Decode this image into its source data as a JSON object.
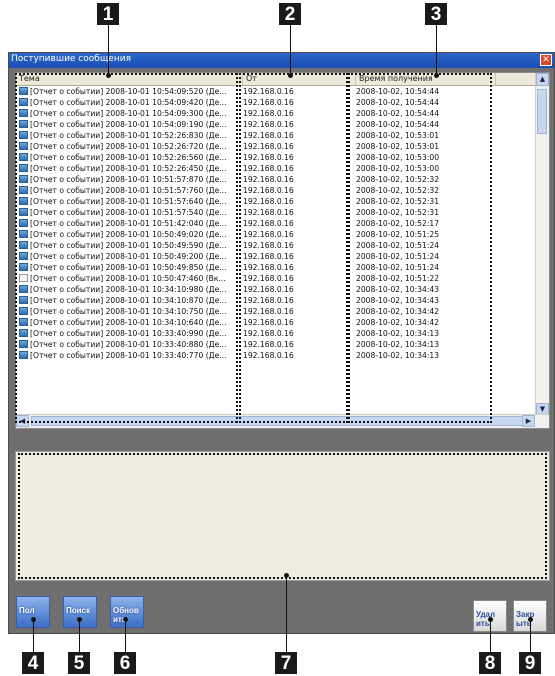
{
  "callouts": [
    "1",
    "2",
    "3",
    "4",
    "5",
    "6",
    "7",
    "8",
    "9"
  ],
  "window": {
    "title": "Поступившие сообщения",
    "close_glyph": "✕"
  },
  "columns": [
    "Тема",
    "От",
    "Время получения"
  ],
  "rows": [
    {
      "subject": "[Отчет о событии] 2008-10-01 10:54:09:520 (Де...",
      "from": "192.168.0.16",
      "time": "2008-10-02, 10:54:44",
      "icon": "blue"
    },
    {
      "subject": "[Отчет о событии] 2008-10-01 10:54:09:420 (Де...",
      "from": "192.168.0.16",
      "time": "2008-10-02, 10:54:44",
      "icon": "blue"
    },
    {
      "subject": "[Отчет о событии] 2008-10-01 10:54:09:300 (Де...",
      "from": "192.168.0.16",
      "time": "2008-10-02, 10:54:44",
      "icon": "blue"
    },
    {
      "subject": "[Отчет о событии] 2008-10-01 10:54:09:190 (Де...",
      "from": "192.168.0.16",
      "time": "2008-10-02, 10:54:44",
      "icon": "blue"
    },
    {
      "subject": "[Отчет о событии] 2008-10-01 10:52:26:830 (Де...",
      "from": "192.168.0.16",
      "time": "2008-10-02, 10:53:01",
      "icon": "blue"
    },
    {
      "subject": "[Отчет о событии] 2008-10-01 10:52:26:720 (Де...",
      "from": "192.168.0.16",
      "time": "2008-10-02, 10:53:01",
      "icon": "blue"
    },
    {
      "subject": "[Отчет о событии] 2008-10-01 10:52:26:560 (Де...",
      "from": "192.168.0.16",
      "time": "2008-10-02, 10:53:00",
      "icon": "blue"
    },
    {
      "subject": "[Отчет о событии] 2008-10-01 10:52:26:450 (Де...",
      "from": "192.168.0.16",
      "time": "2008-10-02, 10:53:00",
      "icon": "blue"
    },
    {
      "subject": "[Отчет о событии] 2008-10-01 10:51:57:870 (Де...",
      "from": "192.168.0.16",
      "time": "2008-10-02, 10:52:32",
      "icon": "blue"
    },
    {
      "subject": "[Отчет о событии] 2008-10-01 10:51:57:760 (Де...",
      "from": "192.168.0.16",
      "time": "2008-10-02, 10:52:32",
      "icon": "blue"
    },
    {
      "subject": "[Отчет о событии] 2008-10-01 10:51:57:640 (Де...",
      "from": "192.168.0.16",
      "time": "2008-10-02, 10:52:31",
      "icon": "blue"
    },
    {
      "subject": "[Отчет о событии] 2008-10-01 10:51:57:540 (Де...",
      "from": "192.168.0.16",
      "time": "2008-10-02, 10:52:31",
      "icon": "blue"
    },
    {
      "subject": "[Отчет о событии] 2008-10-01 10:51:42:040 (Де...",
      "from": "192.168.0.16",
      "time": "2008-10-02, 10:52:17",
      "icon": "blue"
    },
    {
      "subject": "[Отчет о событии] 2008-10-01 10:50:49:020 (Де...",
      "from": "192.168.0.16",
      "time": "2008-10-02, 10:51:25",
      "icon": "blue"
    },
    {
      "subject": "[Отчет о событии] 2008-10-01 10:50:49:590 (Де...",
      "from": "192.168.0.16",
      "time": "2008-10-02, 10:51:24",
      "icon": "blue"
    },
    {
      "subject": "[Отчет о событии] 2008-10-01 10:50:49:200 (Де...",
      "from": "192.168.0.16",
      "time": "2008-10-02, 10:51:24",
      "icon": "blue"
    },
    {
      "subject": "[Отчет о событии] 2008-10-01 10:50:49:850 (Де...",
      "from": "192.168.0.16",
      "time": "2008-10-02, 10:51:24",
      "icon": "blue"
    },
    {
      "subject": "[Отчет о событии] 2008-10-01 10:50:47:460 (Вк...",
      "from": "192.168.0.16",
      "time": "2008-10-02, 10:51:22",
      "icon": "white"
    },
    {
      "subject": "[Отчет о событии] 2008-10-01 10:34:10:980 (Де...",
      "from": "192.168.0.16",
      "time": "2008-10-02, 10:34:43",
      "icon": "blue"
    },
    {
      "subject": "[Отчет о событии] 2008-10-01 10:34:10:870 (Де...",
      "from": "192.168.0.16",
      "time": "2008-10-02, 10:34:43",
      "icon": "blue"
    },
    {
      "subject": "[Отчет о событии] 2008-10-01 10:34:10:750 (Де...",
      "from": "192.168.0.16",
      "time": "2008-10-02, 10:34:42",
      "icon": "blue"
    },
    {
      "subject": "[Отчет о событии] 2008-10-01 10:34:10:640 (Де...",
      "from": "192.168.0.16",
      "time": "2008-10-02, 10:34:42",
      "icon": "blue"
    },
    {
      "subject": "[Отчет о событии] 2008-10-01 10:33:40:990 (Де...",
      "from": "192.168.0.16",
      "time": "2008-10-02, 10:34:13",
      "icon": "blue"
    },
    {
      "subject": "[Отчет о событии] 2008-10-01 10:33:40:880 (Де...",
      "from": "192.168.0.16",
      "time": "2008-10-02, 10:34:13",
      "icon": "blue"
    },
    {
      "subject": "[Отчет о событии] 2008-10-01 10:33:40:770 (Де...",
      "from": "192.168.0.16",
      "time": "2008-10-02, 10:34:13",
      "icon": "blue"
    }
  ],
  "buttons": {
    "properties": "Пол",
    "search": "Поиск",
    "refresh": "Обнов ить",
    "delete": "Удал ить",
    "close": "Закр ыть"
  },
  "colors": {
    "titlebar": "#1a4fb5",
    "window_bg": "#6f6f6f",
    "detail_bg": "#edecdf"
  }
}
